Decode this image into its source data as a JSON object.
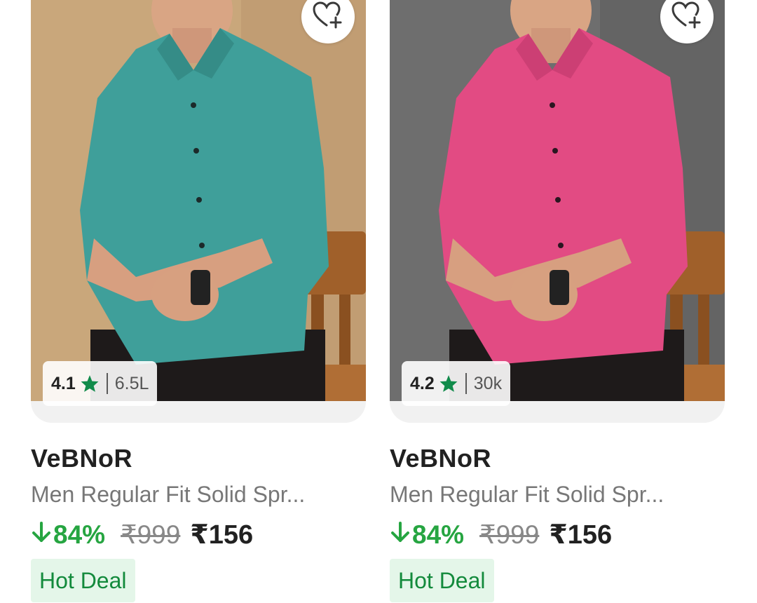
{
  "products": [
    {
      "rating": "4.1",
      "rating_count": "6.5L",
      "brand": "VeBNoR",
      "title": "Men Regular Fit Solid Spr...",
      "discount": "84%",
      "mrp": "₹999",
      "price": "₹156",
      "badge": "Hot Deal",
      "shirt_color": "#3f9f9a",
      "background_color": "#c9a77b",
      "wishlist_icon": "heart-plus-icon",
      "star_icon": "star-icon"
    },
    {
      "rating": "4.2",
      "rating_count": "30k",
      "brand": "VeBNoR",
      "title": "Men Regular Fit Solid Spr...",
      "discount": "84%",
      "mrp": "₹999",
      "price": "₹156",
      "badge": "Hot Deal",
      "shirt_color": "#e24b83",
      "background_color": "#6e6e6e",
      "wishlist_icon": "heart-plus-icon",
      "star_icon": "star-icon"
    }
  ],
  "colors": {
    "discount_green": "#26a541",
    "star_green": "#118b4b",
    "badge_bg": "#e4f6e9",
    "badge_text": "#138a3c"
  }
}
